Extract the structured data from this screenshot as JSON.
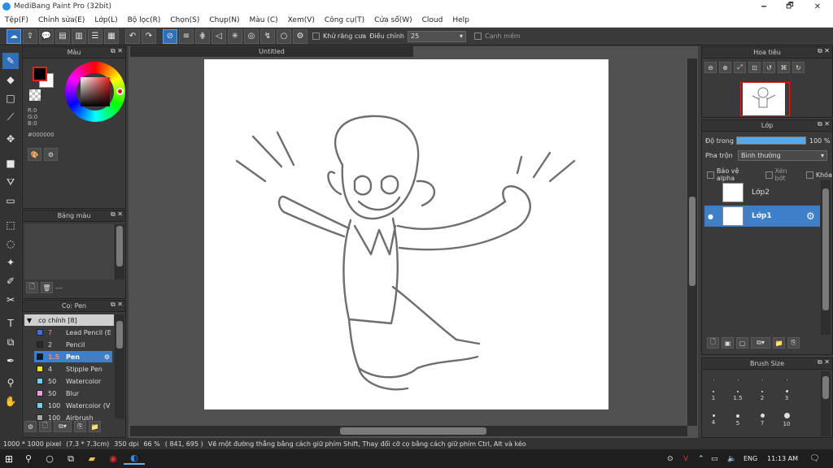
{
  "window": {
    "title": "MediBang Paint Pro (32bit)",
    "minimize": "🗕",
    "maximize": "🗗",
    "close": "✕"
  },
  "menu": [
    "Tệp(F)",
    "Chỉnh sửa(E)",
    "Lớp(L)",
    "Bộ lọc(R)",
    "Chọn(S)",
    "Chụp(N)",
    "Màu (C)",
    "Xem(V)",
    "Công cụ(T)",
    "Cửa sổ(W)",
    "Cloud",
    "Help"
  ],
  "toolbar": {
    "antialias_label": "Khử răng cưa",
    "adjust_label": "Điều chỉnh",
    "adjust_value": "25",
    "edge_label": "Cạnh mềm"
  },
  "document": {
    "tab_title": "Untitled"
  },
  "color_panel": {
    "title": "Màu",
    "r": "R:0",
    "g": "G:0",
    "b": "B:0",
    "hex": "#000000"
  },
  "palette_panel": {
    "title": "Bảng màu",
    "footer": "---"
  },
  "brush_panel": {
    "title": "Cọ: Pen",
    "group": "cọ chính [8]",
    "items": [
      {
        "size": "7",
        "name": "Lead Pencil (E",
        "color": "#3f6fe0",
        "size_color": "#ff8080"
      },
      {
        "size": "2",
        "name": "Pencil",
        "color": "#2a2a2a",
        "size_color": "#dddddd"
      },
      {
        "size": "1.5",
        "name": "Pen",
        "color": "#1a1a1a",
        "size_color": "#ff8080"
      },
      {
        "size": "4",
        "name": "Stipple Pen",
        "color": "#f2e02a",
        "size_color": "#dddddd"
      },
      {
        "size": "50",
        "name": "Watercolor",
        "color": "#6fd0f0",
        "size_color": "#dddddd"
      },
      {
        "size": "50",
        "name": "Blur",
        "color": "#f0a0e0",
        "size_color": "#dddddd"
      },
      {
        "size": "100",
        "name": "Watercolor (V",
        "color": "#6fd0f0",
        "size_color": "#dddddd"
      },
      {
        "size": "100",
        "name": "Airbrush",
        "color": "#aaaaaa",
        "size_color": "#dddddd"
      }
    ]
  },
  "navigator_panel": {
    "title": "Hoa tiêu"
  },
  "layer_panel": {
    "title": "Lớp",
    "opacity_label": "Độ trong",
    "opacity_value": "100 %",
    "opacity_fraction": 1.0,
    "blend_label": "Pha trộn",
    "blend_value": "Bình thường",
    "protect_alpha": "Bảo vệ alpha",
    "clipping": "Xén bớt",
    "lock": "Khóa",
    "layers": [
      "Lớp2",
      "Lớp1"
    ]
  },
  "brushsize_panel": {
    "title": "Brush Size",
    "sizes": [
      "1",
      "1.5",
      "2",
      "3",
      "4",
      "5",
      "7",
      "10"
    ]
  },
  "status": {
    "size": "1000 * 1000 pixel",
    "cm": "(7.3 * 7.3cm)",
    "dpi": "350 dpi",
    "zoom": "66 %",
    "coords": "( 841, 695 )",
    "hint": "Vẽ một đường thẳng bằng cách giữ phím Shift, Thay đổi cỡ cọ bằng cách giữ phím Ctrl, Alt và kéo"
  },
  "taskbar": {
    "lang": "ENG",
    "time": "11:13 AM"
  },
  "colors": {
    "accent": "#3d7fc9",
    "panel": "#3a3a3a",
    "canvas_bg": "#515151"
  }
}
